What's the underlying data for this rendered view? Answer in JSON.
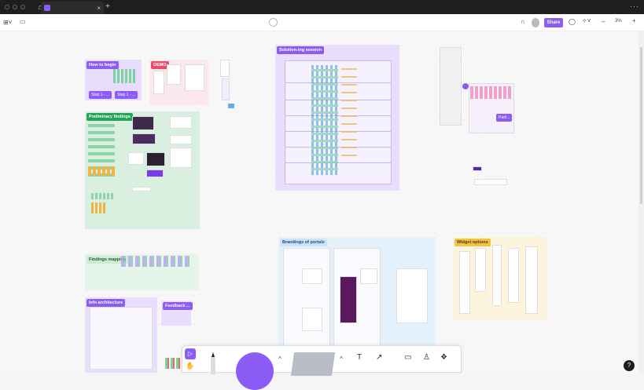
{
  "window": {
    "tab_title": "",
    "close": "×",
    "new_tab": "+",
    "more": "···"
  },
  "toolbar": {
    "share_label": "Share",
    "zoom_label": "3%",
    "zoom_minus": "–",
    "zoom_plus": "+"
  },
  "sections": {
    "how_to_begin": {
      "label": "How to begin",
      "step1": "Step 1 - ...",
      "step2": "Step 1 - ..."
    },
    "demo": {
      "label": "DEMO"
    },
    "preliminary": {
      "label": "Preliminary findings"
    },
    "solutioning": {
      "label": "Solution-ing session"
    },
    "partial": {
      "label": "Parti..."
    },
    "findings_mapping": {
      "label": "Findings mapping"
    },
    "info_arch": {
      "label": "Info architecture"
    },
    "feedback": {
      "label": "Feedback ..."
    },
    "brandings": {
      "label": "Brandings of portals"
    },
    "widget": {
      "label": "Widget options"
    }
  },
  "colors": {
    "accent": "#8b5cf6",
    "green": "#22a559",
    "orange": "#f0a030"
  },
  "bottombar": {
    "pointer": "▷",
    "hand": "✋",
    "caret": "^",
    "text_tool": "T"
  }
}
